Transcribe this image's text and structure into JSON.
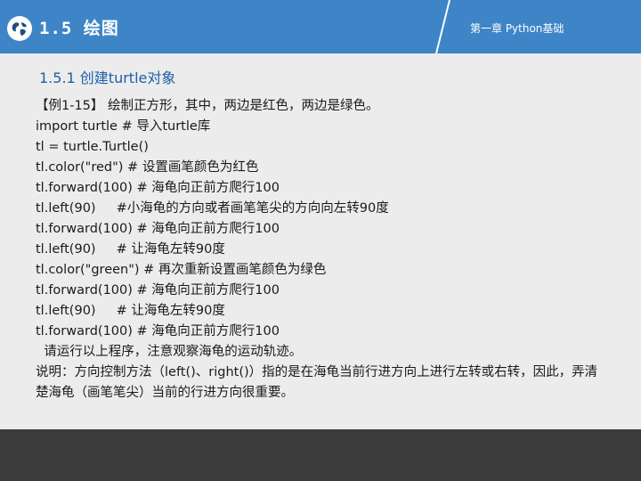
{
  "header": {
    "section": "1.5 绘图",
    "chapter": "第一章 Python基础",
    "logo_icon": "globe-icon"
  },
  "subtitle": "1.5.1 创建turtle对象",
  "lines": [
    "【例1-15】 绘制正方形，其中，两边是红色，两边是绿色。",
    "import turtle # 导入turtle库",
    "tl = turtle.Turtle()",
    "tl.color(\"red\") # 设置画笔颜色为红色",
    "tl.forward(100) # 海龟向正前方爬行100",
    "tl.left(90)     #小海龟的方向或者画笔笔尖的方向向左转90度",
    "tl.forward(100) # 海龟向正前方爬行100",
    "tl.left(90)     # 让海龟左转90度",
    "tl.color(\"green\") # 再次重新设置画笔颜色为绿色",
    "tl.forward(100) # 海龟向正前方爬行100",
    "tl.left(90)     # 让海龟左转90度",
    "tl.forward(100) # 海龟向正前方爬行100",
    "  请运行以上程序，注意观察海龟的运动轨迹。"
  ],
  "note": "  说明：方向控制方法（left()、right()）指的是在海龟当前行进方向上进行左转或右转，因此，弄清楚海龟（画笔笔尖）当前的行进方向很重要。",
  "colors": {
    "header": "#3d85c6",
    "footer": "#3b3b3b",
    "subtitle": "#1d5fa8"
  }
}
